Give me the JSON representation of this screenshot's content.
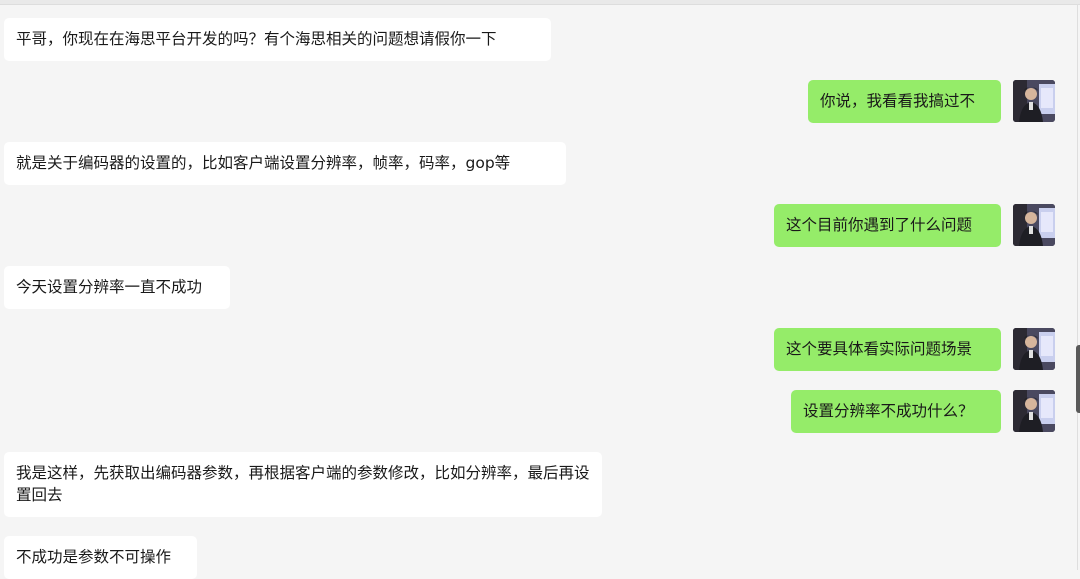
{
  "chat": {
    "messages": [
      {
        "side": "left",
        "text": "平哥，你现在在海思平台开发的吗？有个海思相关的问题想请假你一下"
      },
      {
        "side": "right",
        "text": "你说，我看看我搞过不"
      },
      {
        "side": "left",
        "text": "就是关于编码器的设置的，比如客户端设置分辨率，帧率，码率，gop等"
      },
      {
        "side": "right",
        "text": "这个目前你遇到了什么问题"
      },
      {
        "side": "left",
        "text": "今天设置分辨率一直不成功"
      },
      {
        "side": "right",
        "text": "这个要具体看实际问题场景"
      },
      {
        "side": "right",
        "text": "设置分辨率不成功什么？"
      },
      {
        "side": "left",
        "text": "我是这样，先获取出编码器参数，再根据客户端的参数修改，比如分辨率，最后再设置回去"
      },
      {
        "side": "left",
        "text": "不成功是参数不可操作"
      }
    ]
  },
  "colors": {
    "background": "#f5f5f5",
    "left_bubble": "#ffffff",
    "right_bubble": "#95ec69",
    "text": "#191919"
  },
  "icons": {
    "self_avatar": "user-avatar-photo"
  }
}
